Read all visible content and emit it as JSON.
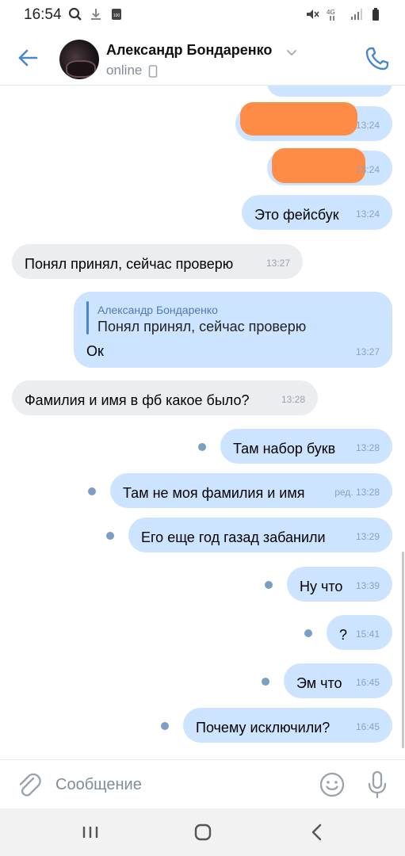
{
  "status_bar": {
    "time": "16:54",
    "network": "4G",
    "icons": [
      "search-icon",
      "download-icon",
      "battery-saver-icon",
      "mute-icon",
      "signal-icon",
      "battery-icon"
    ]
  },
  "header": {
    "contact_name": "Александр Бондаренко",
    "status": "online",
    "icons": [
      "back-arrow-icon",
      "chevron-down-icon",
      "mobile-device-icon",
      "phone-icon"
    ]
  },
  "messages": [
    {
      "direction": "out",
      "text": "",
      "time": "13:24",
      "redacted": true
    },
    {
      "direction": "out",
      "text": "",
      "time": "13:24",
      "redacted": true
    },
    {
      "direction": "out",
      "text": "Это фейсбук",
      "time": "13:24"
    },
    {
      "direction": "in",
      "text": "Понял принял, сейчас проверю",
      "time": "13:27"
    },
    {
      "direction": "out",
      "text": "Ок",
      "time": "13:27",
      "reply": {
        "author": "Александр Бондаренко",
        "text": "Понял принял, сейчас проверю"
      }
    },
    {
      "direction": "in",
      "text": "Фамилия и имя в фб какое было?",
      "time": "13:28"
    },
    {
      "direction": "out",
      "text": "Там набор букв",
      "time": "13:28",
      "unread": true
    },
    {
      "direction": "out",
      "text": "Там не моя фамилия и имя",
      "time": "ред. 13:28",
      "unread": true
    },
    {
      "direction": "out",
      "text": "Его еще год газад забанили",
      "time": "13:29",
      "unread": true
    },
    {
      "direction": "out",
      "text": "Ну что",
      "time": "13:39",
      "unread": true
    },
    {
      "direction": "out",
      "text": "?",
      "time": "15:41",
      "unread": true
    },
    {
      "direction": "out",
      "text": "Эм что",
      "time": "16:45",
      "unread": true
    },
    {
      "direction": "out",
      "text": "Почему исключили?",
      "time": "16:45",
      "unread": true
    }
  ],
  "composer": {
    "placeholder": "Сообщение",
    "icons": [
      "attach-icon",
      "emoji-icon",
      "microphone-icon"
    ]
  },
  "nav": {
    "buttons": [
      "recent-apps",
      "home",
      "back"
    ]
  },
  "colors": {
    "accent": "#4986cc",
    "outgoing_bubble": "#cce4ff",
    "incoming_bubble": "#ebedf0",
    "redaction": "#ff8c46",
    "unread_dot": "#7a9ec4"
  }
}
